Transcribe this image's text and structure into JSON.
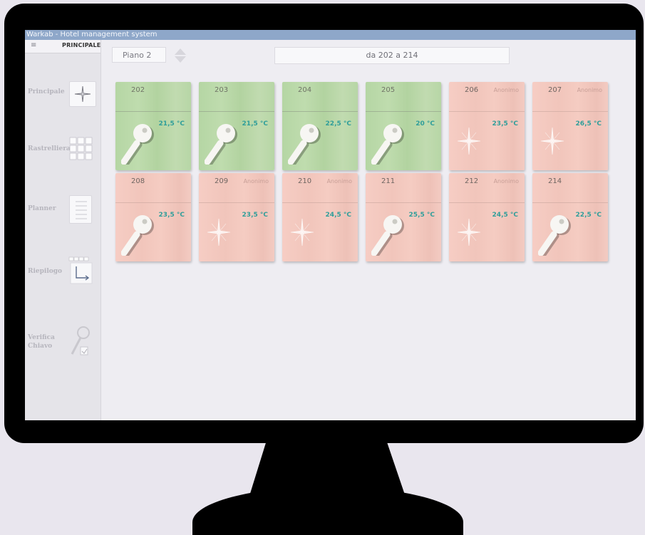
{
  "window": {
    "title": "Warkab - Hotel management system"
  },
  "sidebar": {
    "header_label": "PRINCIPALE",
    "menu_icon": "hamburger-icon",
    "items": [
      {
        "label": "Principale",
        "icon": "sparkle-icon"
      },
      {
        "label": "Rastrelliera",
        "icon": "grid-icon"
      },
      {
        "label": "Planner",
        "icon": "list-icon"
      },
      {
        "label": "Riepilogo",
        "icon": "summary-arrow-icon"
      },
      {
        "label_line1": "Verifica",
        "label_line2": "Chiavo",
        "icon": "key-check-icon"
      }
    ]
  },
  "toolbar": {
    "floor_label": "Piano 2",
    "range_label": "da 202 a 214"
  },
  "colors": {
    "free_room": "#b7d6a6",
    "occupied_room": "#f3cbc2",
    "temperature_text": "#2f9e9a",
    "titlebar": "#8ea7c9"
  },
  "rooms": [
    {
      "number": "202",
      "guest": "",
      "temperature": "21,5 °C",
      "status": "free",
      "icon": "key-icon"
    },
    {
      "number": "203",
      "guest": "",
      "temperature": "21,5 °C",
      "status": "free",
      "icon": "key-icon"
    },
    {
      "number": "204",
      "guest": "",
      "temperature": "22,5 °C",
      "status": "free",
      "icon": "key-icon"
    },
    {
      "number": "205",
      "guest": "",
      "temperature": "20 °C",
      "status": "free",
      "icon": "key-icon"
    },
    {
      "number": "206",
      "guest": "Anonimo",
      "temperature": "23,5 °C",
      "status": "occupied",
      "icon": "sparkle-icon"
    },
    {
      "number": "207",
      "guest": "Anonimo",
      "temperature": "26,5 °C",
      "status": "occupied",
      "icon": "sparkle-icon"
    },
    {
      "number": "208",
      "guest": "",
      "temperature": "23,5 °C",
      "status": "occupied",
      "icon": "key-icon"
    },
    {
      "number": "209",
      "guest": "Anonimo",
      "temperature": "23,5 °C",
      "status": "occupied",
      "icon": "sparkle-icon"
    },
    {
      "number": "210",
      "guest": "Anonimo",
      "temperature": "24,5 °C",
      "status": "occupied",
      "icon": "sparkle-icon"
    },
    {
      "number": "211",
      "guest": "",
      "temperature": "25,5 °C",
      "status": "occupied",
      "icon": "key-icon"
    },
    {
      "number": "212",
      "guest": "Anonimo",
      "temperature": "24,5 °C",
      "status": "occupied",
      "icon": "sparkle-icon"
    },
    {
      "number": "214",
      "guest": "",
      "temperature": "22,5 °C",
      "status": "occupied",
      "icon": "key-icon"
    }
  ]
}
